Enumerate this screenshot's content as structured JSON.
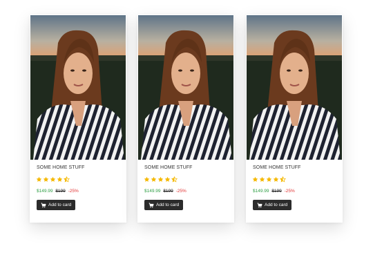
{
  "products": [
    {
      "title": "SOME HOME STUFF",
      "rating": 4.5,
      "price": "$149.99",
      "old_price": "$199",
      "discount": "-25%",
      "button_label": "Add to card",
      "button_icon": "cart-icon"
    },
    {
      "title": "SOME HOME STUFF",
      "rating": 4.5,
      "price": "$149.99",
      "old_price": "$199",
      "discount": "-25%",
      "button_label": "Add to card",
      "button_icon": "cart-icon"
    },
    {
      "title": "SOME HOME STUFF",
      "rating": 4.5,
      "price": "$149.99",
      "old_price": "$199",
      "discount": "-25%",
      "button_label": "Add to card",
      "button_icon": "cart-icon"
    }
  ],
  "colors": {
    "star": "#f5b800",
    "price": "#2f9e44",
    "discount": "#e03131",
    "button": "#2b2b2b"
  }
}
